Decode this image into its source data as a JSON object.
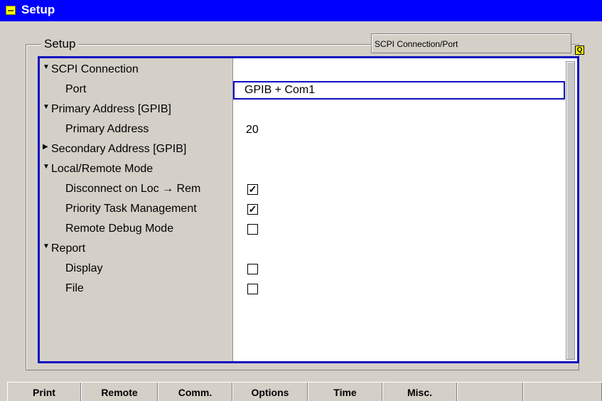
{
  "window": {
    "title": "Setup"
  },
  "group": {
    "label": "Setup",
    "path": "SCPI Connection/Port"
  },
  "tree": [
    {
      "label": "SCPI Connection",
      "type": "group",
      "expanded": true
    },
    {
      "label": "Port",
      "type": "field",
      "value": "GPIB + Com1"
    },
    {
      "label": "Primary Address [GPIB]",
      "type": "group",
      "expanded": true
    },
    {
      "label": "Primary Address",
      "type": "value",
      "value": "20"
    },
    {
      "label": "Secondary Address [GPIB]",
      "type": "group",
      "expanded": false
    },
    {
      "label": "Local/Remote Mode",
      "type": "group",
      "expanded": true
    },
    {
      "label": "Disconnect on Loc → Rem",
      "type": "checkbox",
      "checked": true
    },
    {
      "label": "Priority Task Management",
      "type": "checkbox",
      "checked": true
    },
    {
      "label": "Remote Debug Mode",
      "type": "checkbox",
      "checked": false
    },
    {
      "label": "Report",
      "type": "group",
      "expanded": true
    },
    {
      "label": "Display",
      "type": "checkbox",
      "checked": false
    },
    {
      "label": "File",
      "type": "checkbox",
      "checked": false
    }
  ],
  "tabs": [
    "Print",
    "Remote",
    "Comm.",
    "Options",
    "Time",
    "Misc.",
    "",
    ""
  ],
  "active_tab": "Remote",
  "colors": {
    "title_bar": "#0000ff",
    "focus_border": "#1010c0",
    "background": "#d4d0c8"
  }
}
